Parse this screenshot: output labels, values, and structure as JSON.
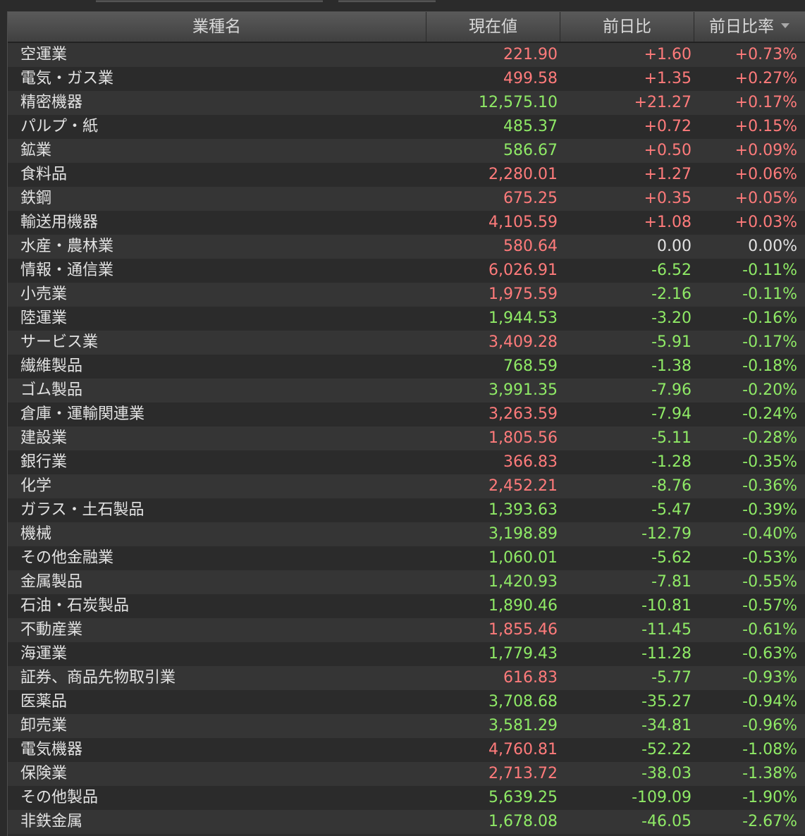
{
  "header": {
    "name": "業種名",
    "price": "現在値",
    "diff": "前日比",
    "pct": "前日比率"
  },
  "colors": {
    "up": "#ff7b7b",
    "down": "#8fea66",
    "neutral": "#e2e2e2",
    "background": "#2b2b2b"
  },
  "sort_icon": "triangle-down-icon",
  "rows": [
    {
      "name": "空運業",
      "price": "221.90",
      "price_dir": "up",
      "diff": "+1.60",
      "pct": "+0.73%",
      "change_dir": "up"
    },
    {
      "name": "電気・ガス業",
      "price": "499.58",
      "price_dir": "up",
      "diff": "+1.35",
      "pct": "+0.27%",
      "change_dir": "up"
    },
    {
      "name": "精密機器",
      "price": "12,575.10",
      "price_dir": "dn",
      "diff": "+21.27",
      "pct": "+0.17%",
      "change_dir": "up"
    },
    {
      "name": "パルプ・紙",
      "price": "485.37",
      "price_dir": "dn",
      "diff": "+0.72",
      "pct": "+0.15%",
      "change_dir": "up"
    },
    {
      "name": "鉱業",
      "price": "586.67",
      "price_dir": "dn",
      "diff": "+0.50",
      "pct": "+0.09%",
      "change_dir": "up"
    },
    {
      "name": "食料品",
      "price": "2,280.01",
      "price_dir": "up",
      "diff": "+1.27",
      "pct": "+0.06%",
      "change_dir": "up"
    },
    {
      "name": "鉄鋼",
      "price": "675.25",
      "price_dir": "up",
      "diff": "+0.35",
      "pct": "+0.05%",
      "change_dir": "up"
    },
    {
      "name": "輸送用機器",
      "price": "4,105.59",
      "price_dir": "up",
      "diff": "+1.08",
      "pct": "+0.03%",
      "change_dir": "up"
    },
    {
      "name": "水産・農林業",
      "price": "580.64",
      "price_dir": "up",
      "diff": "0.00",
      "pct": "0.00%",
      "change_dir": "flat"
    },
    {
      "name": "情報・通信業",
      "price": "6,026.91",
      "price_dir": "up",
      "diff": "-6.52",
      "pct": "-0.11%",
      "change_dir": "dn"
    },
    {
      "name": "小売業",
      "price": "1,975.59",
      "price_dir": "up",
      "diff": "-2.16",
      "pct": "-0.11%",
      "change_dir": "dn"
    },
    {
      "name": "陸運業",
      "price": "1,944.53",
      "price_dir": "dn",
      "diff": "-3.20",
      "pct": "-0.16%",
      "change_dir": "dn"
    },
    {
      "name": "サービス業",
      "price": "3,409.28",
      "price_dir": "up",
      "diff": "-5.91",
      "pct": "-0.17%",
      "change_dir": "dn"
    },
    {
      "name": "繊維製品",
      "price": "768.59",
      "price_dir": "dn",
      "diff": "-1.38",
      "pct": "-0.18%",
      "change_dir": "dn"
    },
    {
      "name": "ゴム製品",
      "price": "3,991.35",
      "price_dir": "dn",
      "diff": "-7.96",
      "pct": "-0.20%",
      "change_dir": "dn"
    },
    {
      "name": "倉庫・運輸関連業",
      "price": "3,263.59",
      "price_dir": "up",
      "diff": "-7.94",
      "pct": "-0.24%",
      "change_dir": "dn"
    },
    {
      "name": "建設業",
      "price": "1,805.56",
      "price_dir": "up",
      "diff": "-5.11",
      "pct": "-0.28%",
      "change_dir": "dn"
    },
    {
      "name": "銀行業",
      "price": "366.83",
      "price_dir": "up",
      "diff": "-1.28",
      "pct": "-0.35%",
      "change_dir": "dn"
    },
    {
      "name": "化学",
      "price": "2,452.21",
      "price_dir": "up",
      "diff": "-8.76",
      "pct": "-0.36%",
      "change_dir": "dn"
    },
    {
      "name": "ガラス・土石製品",
      "price": "1,393.63",
      "price_dir": "dn",
      "diff": "-5.47",
      "pct": "-0.39%",
      "change_dir": "dn"
    },
    {
      "name": "機械",
      "price": "3,198.89",
      "price_dir": "dn",
      "diff": "-12.79",
      "pct": "-0.40%",
      "change_dir": "dn"
    },
    {
      "name": "その他金融業",
      "price": "1,060.01",
      "price_dir": "dn",
      "diff": "-5.62",
      "pct": "-0.53%",
      "change_dir": "dn"
    },
    {
      "name": "金属製品",
      "price": "1,420.93",
      "price_dir": "dn",
      "diff": "-7.81",
      "pct": "-0.55%",
      "change_dir": "dn"
    },
    {
      "name": "石油・石炭製品",
      "price": "1,890.46",
      "price_dir": "dn",
      "diff": "-10.81",
      "pct": "-0.57%",
      "change_dir": "dn"
    },
    {
      "name": "不動産業",
      "price": "1,855.46",
      "price_dir": "up",
      "diff": "-11.45",
      "pct": "-0.61%",
      "change_dir": "dn"
    },
    {
      "name": "海運業",
      "price": "1,779.43",
      "price_dir": "dn",
      "diff": "-11.28",
      "pct": "-0.63%",
      "change_dir": "dn"
    },
    {
      "name": "証券、商品先物取引業",
      "price": "616.83",
      "price_dir": "up",
      "diff": "-5.77",
      "pct": "-0.93%",
      "change_dir": "dn"
    },
    {
      "name": "医薬品",
      "price": "3,708.68",
      "price_dir": "dn",
      "diff": "-35.27",
      "pct": "-0.94%",
      "change_dir": "dn"
    },
    {
      "name": "卸売業",
      "price": "3,581.29",
      "price_dir": "dn",
      "diff": "-34.81",
      "pct": "-0.96%",
      "change_dir": "dn"
    },
    {
      "name": "電気機器",
      "price": "4,760.81",
      "price_dir": "up",
      "diff": "-52.22",
      "pct": "-1.08%",
      "change_dir": "dn"
    },
    {
      "name": "保険業",
      "price": "2,713.72",
      "price_dir": "up",
      "diff": "-38.03",
      "pct": "-1.38%",
      "change_dir": "dn"
    },
    {
      "name": "その他製品",
      "price": "5,639.25",
      "price_dir": "dn",
      "diff": "-109.09",
      "pct": "-1.90%",
      "change_dir": "dn"
    },
    {
      "name": "非鉄金属",
      "price": "1,678.08",
      "price_dir": "dn",
      "diff": "-46.05",
      "pct": "-2.67%",
      "change_dir": "dn"
    }
  ]
}
